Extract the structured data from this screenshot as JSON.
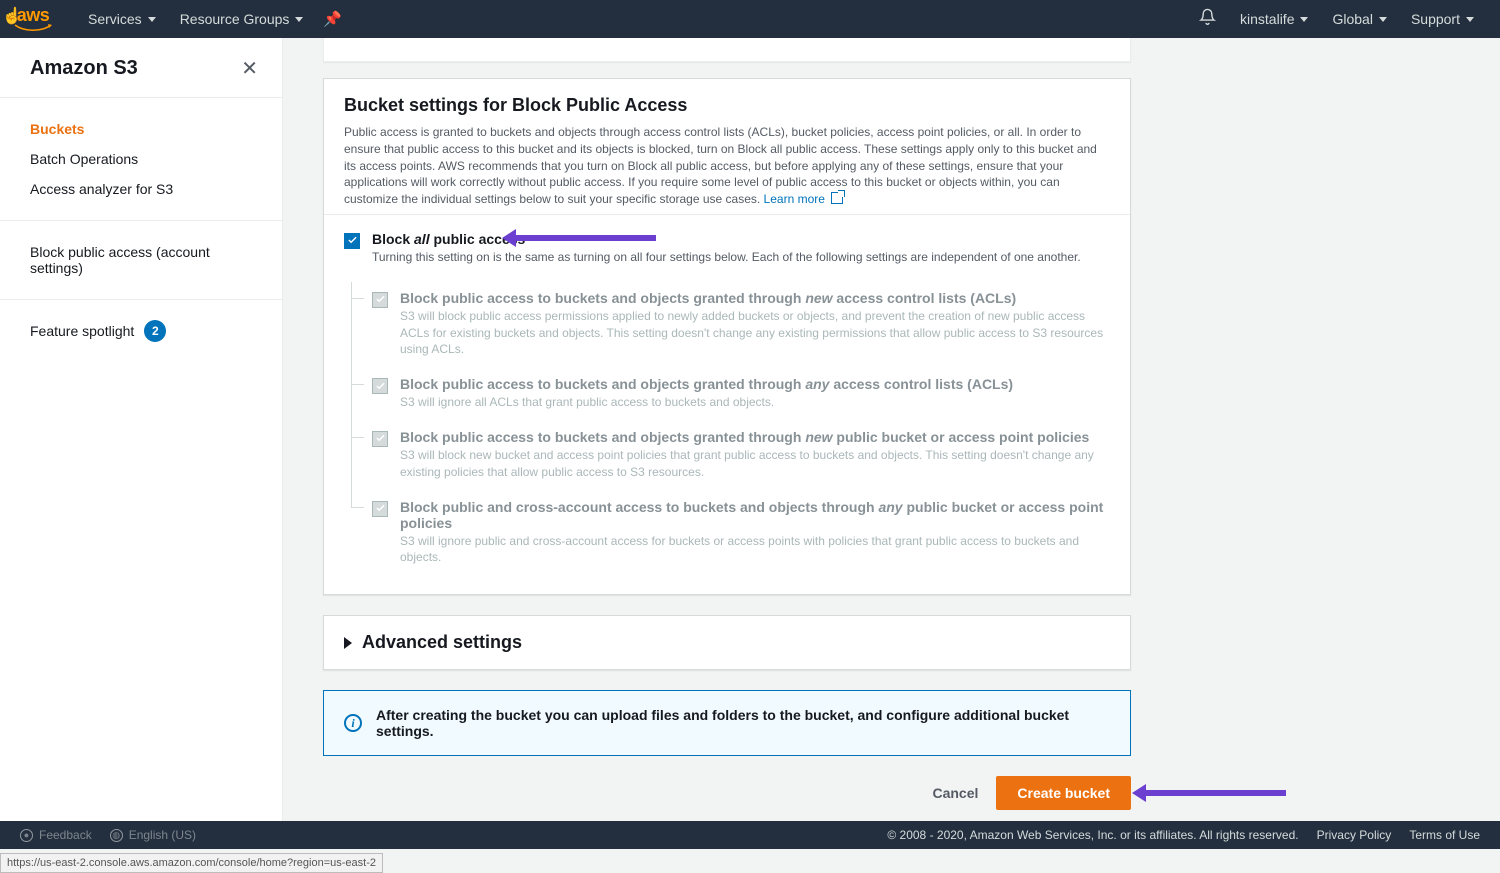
{
  "topnav": {
    "logo_text": "aws",
    "services": "Services",
    "resource_groups": "Resource Groups",
    "account": "kinstalife",
    "region": "Global",
    "support": "Support"
  },
  "sidebar": {
    "title": "Amazon S3",
    "group1": {
      "buckets": "Buckets",
      "batch": "Batch Operations",
      "analyzer": "Access analyzer for S3"
    },
    "group2": {
      "block": "Block public access (account settings)"
    },
    "feature": {
      "label": "Feature spotlight",
      "count": "2"
    }
  },
  "panel": {
    "heading": "Bucket settings for Block Public Access",
    "desc": "Public access is granted to buckets and objects through access control lists (ACLs), bucket policies, access point policies, or all. In order to ensure that public access to this bucket and its objects is blocked, turn on Block all public access. These settings apply only to this bucket and its access points. AWS recommends that you turn on Block all public access, but before applying any of these settings, ensure that your applications will work correctly without public access. If you require some level of public access to this bucket or objects within, you can customize the individual settings below to suit your specific storage use cases. ",
    "learn": "Learn more",
    "master": {
      "t_pre": "Block ",
      "t_it": "all",
      "t_post": " public access",
      "desc": "Turning this setting on is the same as turning on all four settings below. Each of the following settings are independent of one another."
    },
    "subs": [
      {
        "pre": "Block public access to buckets and objects granted through ",
        "it": "new",
        "post": " access control lists (ACLs)",
        "desc": "S3 will block public access permissions applied to newly added buckets or objects, and prevent the creation of new public access ACLs for existing buckets and objects. This setting doesn't change any existing permissions that allow public access to S3 resources using ACLs."
      },
      {
        "pre": "Block public access to buckets and objects granted through ",
        "it": "any",
        "post": " access control lists (ACLs)",
        "desc": "S3 will ignore all ACLs that grant public access to buckets and objects."
      },
      {
        "pre": "Block public access to buckets and objects granted through ",
        "it": "new",
        "post": " public bucket or access point policies",
        "desc": "S3 will block new bucket and access point policies that grant public access to buckets and objects. This setting doesn't change any existing policies that allow public access to S3 resources."
      },
      {
        "pre": "Block public and cross-account access to buckets and objects through ",
        "it": "any",
        "post": " public bucket or access point policies",
        "desc": "S3 will ignore public and cross-account access for buckets or access points with policies that grant public access to buckets and objects."
      }
    ],
    "advanced": "Advanced settings",
    "info": "After creating the bucket you can upload files and folders to the bucket, and configure additional bucket settings.",
    "cancel": "Cancel",
    "create": "Create bucket"
  },
  "footer": {
    "feedback": "Feedback",
    "language": "English (US)",
    "copyright": "© 2008 - 2020, Amazon Web Services, Inc. or its affiliates. All rights reserved.",
    "privacy": "Privacy Policy",
    "terms": "Terms of Use"
  },
  "status_url": "https://us-east-2.console.aws.amazon.com/console/home?region=us-east-2"
}
